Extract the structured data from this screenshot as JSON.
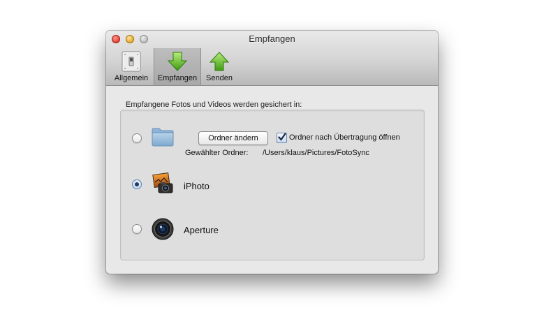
{
  "window": {
    "title": "Empfangen"
  },
  "toolbar": {
    "items": [
      {
        "label": "Allgemein",
        "icon": "switch-icon"
      },
      {
        "label": "Empfangen",
        "icon": "arrow-down-icon",
        "selected": true
      },
      {
        "label": "Senden",
        "icon": "arrow-up-icon"
      }
    ]
  },
  "content": {
    "heading": "Empfangene Fotos und Videos werden gesichert in:",
    "folder_option": {
      "selected": false,
      "icon": "folder-icon",
      "change_button": "Ordner ändern",
      "open_after_transfer_label": "Ordner nach Übertragung öffnen",
      "open_after_transfer_checked": true,
      "selected_folder_label": "Gewählter Ordner:",
      "selected_folder_path": "/Users/klaus/Pictures/FotoSync"
    },
    "iphoto_option": {
      "selected": true,
      "icon": "iphoto-icon",
      "label": "iPhoto"
    },
    "aperture_option": {
      "selected": false,
      "icon": "aperture-icon",
      "label": "Aperture"
    }
  },
  "colors": {
    "arrow_green": "#5fb52a",
    "radio_selected": "#233a5e",
    "window_bg": "#e8e8e8"
  }
}
